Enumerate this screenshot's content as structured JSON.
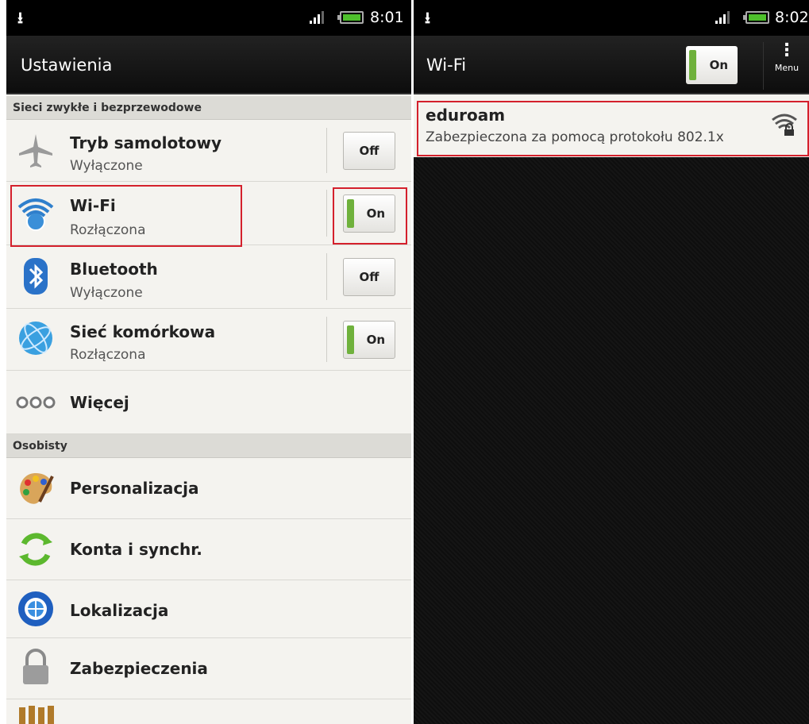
{
  "left": {
    "status_time": "8:01",
    "title": "Ustawienia",
    "section1": "Sieci zwykłe i bezprzewodowe",
    "items": [
      {
        "title": "Tryb samolotowy",
        "sub": "Wyłączone",
        "toggle": "Off",
        "icon": "airplane-icon"
      },
      {
        "title": "Wi-Fi",
        "sub": "Rozłączona",
        "toggle": "On",
        "icon": "wifi-icon"
      },
      {
        "title": "Bluetooth",
        "sub": "Wyłączone",
        "toggle": "Off",
        "icon": "bluetooth-icon"
      },
      {
        "title": "Sieć komórkowa",
        "sub": "Rozłączona",
        "toggle": "On",
        "icon": "globe-icon"
      }
    ],
    "more": "Więcej",
    "section2": "Osobisty",
    "personal": [
      {
        "title": "Personalizacja",
        "icon": "palette-icon"
      },
      {
        "title": "Konta i synchr.",
        "icon": "sync-icon"
      },
      {
        "title": "Lokalizacja",
        "icon": "location-icon"
      },
      {
        "title": "Zabezpieczenia",
        "icon": "lock-icon"
      }
    ]
  },
  "right": {
    "status_time": "8:02",
    "title": "Wi-Fi",
    "toggle": "On",
    "menu_label": "Menu",
    "network": {
      "name": "eduroam",
      "desc": "Zabezpieczona za pomocą protokołu 802.1x"
    }
  },
  "colors": {
    "highlight": "#d4202c",
    "toggle_on": "#6fb13c"
  }
}
